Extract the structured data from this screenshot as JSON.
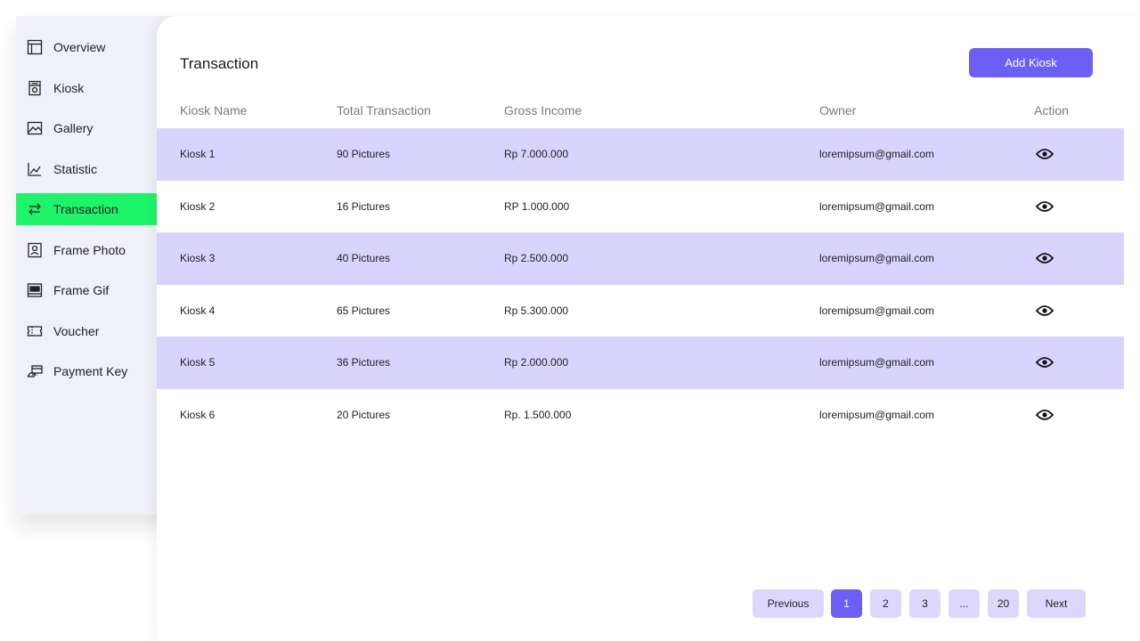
{
  "sidebar": {
    "items": [
      {
        "label": "Overview",
        "icon": "layout-icon"
      },
      {
        "label": "Kiosk",
        "icon": "kiosk-icon"
      },
      {
        "label": "Gallery",
        "icon": "image-icon"
      },
      {
        "label": "Statistic",
        "icon": "chart-icon"
      },
      {
        "label": "Transaction",
        "icon": "arrows-icon",
        "active": true
      },
      {
        "label": "Frame Photo",
        "icon": "portrait-icon"
      },
      {
        "label": "Frame Gif",
        "icon": "gif-icon"
      },
      {
        "label": "Voucher",
        "icon": "ticket-icon"
      },
      {
        "label": "Payment Key",
        "icon": "payment-icon"
      }
    ]
  },
  "main": {
    "title": "Transaction",
    "add_button": "Add Kiosk"
  },
  "table": {
    "headers": [
      "Kiosk Name",
      "Total Transaction",
      "Gross Income",
      "Owner",
      "Action"
    ],
    "rows": [
      {
        "name": "Kiosk 1",
        "total": "90 Pictures",
        "income": "Rp 7.000.000",
        "owner": "loremipsum@gmail.com"
      },
      {
        "name": "Kiosk 2",
        "total": "16 Pictures",
        "income": "RP 1.000.000",
        "owner": "loremipsum@gmail.com"
      },
      {
        "name": "Kiosk 3",
        "total": "40 Pictures",
        "income": "Rp 2.500.000",
        "owner": "loremipsum@gmail.com"
      },
      {
        "name": "Kiosk 4",
        "total": "65 Pictures",
        "income": "Rp 5.300.000",
        "owner": "loremipsum@gmail.com"
      },
      {
        "name": "Kiosk 5",
        "total": "36 Pictures",
        "income": "Rp 2.000.000",
        "owner": "loremipsum@gmail.com"
      },
      {
        "name": "Kiosk 6",
        "total": "20 Pictures",
        "income": "Rp. 1.500.000",
        "owner": "loremipsum@gmail.com"
      }
    ],
    "action_icon": "eye-icon"
  },
  "pagination": {
    "previous": "Previous",
    "pages": [
      "1",
      "2",
      "3",
      "...",
      "20"
    ],
    "current": "1",
    "next": "Next"
  },
  "colors": {
    "accent": "#6c5ff5",
    "active_nav": "#1ef46a",
    "row_shade": "#d9d4fd",
    "sidebar_bg": "#eef1f7"
  }
}
